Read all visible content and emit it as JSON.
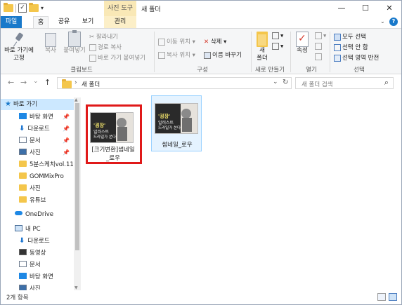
{
  "qat": {
    "dropdown": "▾"
  },
  "window": {
    "context_tab": "사진 도구",
    "title": "새 폴더",
    "minimize": "—",
    "maximize": "☐",
    "close": "✕"
  },
  "tabs": {
    "file": "파일",
    "home": "홈",
    "share": "공유",
    "view": "보기",
    "manage": "관리",
    "collapse": "⌄",
    "help": "?"
  },
  "ribbon": {
    "clipboard": {
      "label": "클립보드",
      "pin_quick": "바로 가기에\n고정",
      "copy": "복사",
      "paste": "붙여넣기",
      "cut": "잘라내기",
      "copy_path": "경로 복사",
      "paste_shortcut": "바로 가기 붙여넣기"
    },
    "organize": {
      "label": "구성",
      "move_to": "이동 위치 ▾",
      "copy_to": "복사 위치 ▾",
      "delete": "삭제 ▾",
      "rename": "이름 바꾸기"
    },
    "new": {
      "label": "새로 만들기",
      "new_folder": "새\n폴더"
    },
    "open": {
      "label": "열기",
      "properties": "속성"
    },
    "select": {
      "label": "선택",
      "select_all": "모두 선택",
      "select_none": "선택 안 함",
      "invert": "선택 영역 반전"
    }
  },
  "nav": {
    "back": "←",
    "forward": "→",
    "recent": "⌄",
    "up": "↑",
    "breadcrumb_sep": "›",
    "path": "새 폴더",
    "path_dropdown": "⌄",
    "refresh": "↻",
    "search_placeholder": "새 폴더 검색",
    "search_icon": "⌕"
  },
  "navpane": {
    "quick_access": "바로 가기",
    "items": [
      {
        "label": "바탕 화면",
        "icon": "desktop-icon",
        "pinned": true
      },
      {
        "label": "다운로드",
        "icon": "download-icon",
        "pinned": true
      },
      {
        "label": "문서",
        "icon": "document-icon",
        "pinned": true
      },
      {
        "label": "사진",
        "icon": "pictures-icon",
        "pinned": true
      },
      {
        "label": "5분스케치vol.11",
        "icon": "folder-icon",
        "pinned": false
      },
      {
        "label": "GOMMixPro",
        "icon": "folder-icon",
        "pinned": false
      },
      {
        "label": "사진",
        "icon": "folder-icon",
        "pinned": false
      },
      {
        "label": "유튜브",
        "icon": "folder-icon",
        "pinned": false
      }
    ],
    "onedrive": "OneDrive",
    "this_pc": "내 PC",
    "pc_items": [
      {
        "label": "다운로드",
        "icon": "download-icon"
      },
      {
        "label": "동영상",
        "icon": "video-icon"
      },
      {
        "label": "문서",
        "icon": "document-icon"
      },
      {
        "label": "바탕 화면",
        "icon": "desktop-icon"
      },
      {
        "label": "사진",
        "icon": "pictures-icon"
      }
    ]
  },
  "files": [
    {
      "name": "[크기변환]썸네일\n_로우",
      "thumb_title": "'굉장'",
      "thumb_sub": "일러스트",
      "thumb_sub2": "드라일가 쏜다"
    },
    {
      "name": "썸네일_로우",
      "thumb_title": "'굉장'",
      "thumb_sub": "일러스트",
      "thumb_sub2": "드라일가 쏜다"
    }
  ],
  "status": {
    "count": "2개 항목"
  },
  "colors": {
    "accent": "#1979ca",
    "highlight_box": "#e01919",
    "context_tab": "#f9e8b6"
  }
}
